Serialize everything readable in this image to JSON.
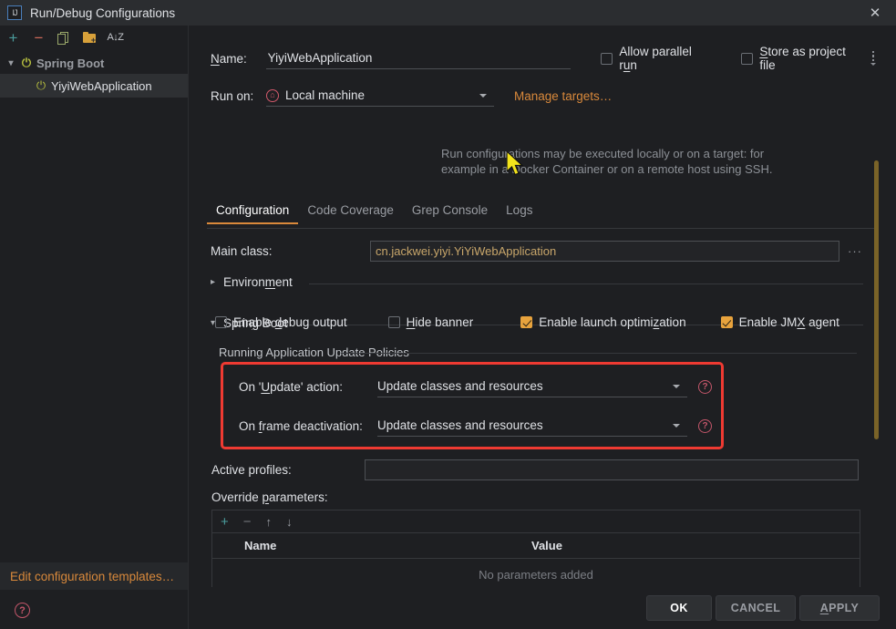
{
  "window": {
    "title": "Run/Debug Configurations",
    "app_icon": "IJ",
    "close_icon": "close-icon"
  },
  "sidebar": {
    "toolbar": [
      {
        "name": "add",
        "icon": "plus-icon",
        "glyph": "+"
      },
      {
        "name": "remove",
        "icon": "minus-icon",
        "glyph": "−"
      },
      {
        "name": "copy",
        "icon": "copy-icon",
        "glyph": ""
      },
      {
        "name": "new-folder",
        "icon": "folder-add-icon",
        "glyph": "+"
      },
      {
        "name": "sort",
        "icon": "sort-alphabetically-icon",
        "glyph": "A↓Z"
      }
    ],
    "tree": {
      "group_label": "Spring Boot",
      "items": [
        {
          "label": "YiyiWebApplication",
          "selected": true
        }
      ]
    },
    "edit_templates_label": "Edit configuration templates…",
    "help_glyph": "?"
  },
  "form": {
    "name_label": "Name:",
    "name_label_mnemonic": "N",
    "name_value": "YiyiWebApplication",
    "name_placeholder": "",
    "allow_parallel_run": {
      "label": "Allow parallel run",
      "checked": false,
      "mnemonic": "u"
    },
    "store_as_project_file": {
      "label": "Store as project file",
      "checked": false,
      "mnemonic": "S"
    },
    "run_on_label": "Run on:",
    "run_on_value": "Local machine",
    "run_on_icon": "local-machine-icon",
    "manage_targets_label": "Manage targets…",
    "hint_line1": "Run configurations may be executed locally or on a target: for",
    "hint_line2": "example in a Docker Container or on a remote host using SSH."
  },
  "tabs": [
    {
      "label": "Configuration",
      "active": true
    },
    {
      "label": "Code Coverage",
      "active": false
    },
    {
      "label": "Grep Console",
      "active": false
    },
    {
      "label": "Logs",
      "active": false
    }
  ],
  "configuration": {
    "main_class_label": "Main class:",
    "main_class_value": "cn.jackwei.yiyi.YiYiWebApplication",
    "main_class_browse": "···",
    "environment_section": {
      "label": "Environment",
      "expanded": false,
      "chevron": "›",
      "mnemonic": "m"
    },
    "spring_boot_section": {
      "label": "Spring Boot",
      "expanded": true,
      "chevron": "⌄",
      "mnemonic": "g"
    },
    "spring_boot_checks": [
      {
        "label": "Enable debug output",
        "checked": false,
        "mnemonic": "d"
      },
      {
        "label": "Hide banner",
        "checked": false,
        "mnemonic": "H"
      },
      {
        "label": "Enable launch optimization",
        "checked": true,
        "mnemonic": "z"
      },
      {
        "label": "Enable JMX agent",
        "checked": true,
        "mnemonic": "X"
      }
    ],
    "update_policies": {
      "section_label": "Running Application Update Policies",
      "highlighted": true,
      "highlight_color": "#ef3a32",
      "rows": [
        {
          "label": "On 'Update' action:",
          "value": "Update classes and resources",
          "help_icon": "help-circle-icon"
        },
        {
          "label": "On frame deactivation:",
          "value": "Update classes and resources",
          "help_icon": "help-circle-icon"
        }
      ]
    },
    "active_profiles_label": "Active profiles:",
    "active_profiles_value": "",
    "override_parameters_label": "Override parameters:",
    "param_toolbar": [
      {
        "name": "add-parameter",
        "glyph": "+"
      },
      {
        "name": "remove-parameter",
        "glyph": "−"
      },
      {
        "name": "move-up",
        "glyph": "↑"
      },
      {
        "name": "move-down",
        "glyph": "↓"
      }
    ],
    "param_table": {
      "columns": [
        "Name",
        "Value"
      ],
      "rows": [],
      "empty_text": "No parameters added"
    }
  },
  "footer": {
    "buttons": [
      {
        "label": "OK",
        "primary": true
      },
      {
        "label": "CANCEL",
        "primary": false
      },
      {
        "label": "APPLY",
        "primary": false,
        "mnemonic": "A"
      }
    ]
  },
  "colors": {
    "accent": "#d9893b",
    "highlight": "#ef3a32",
    "checkbox_checked": "#e8a33d",
    "scrollbar": "#7a6328",
    "background": "#1e1f22",
    "titlebar": "#2b2d30"
  }
}
